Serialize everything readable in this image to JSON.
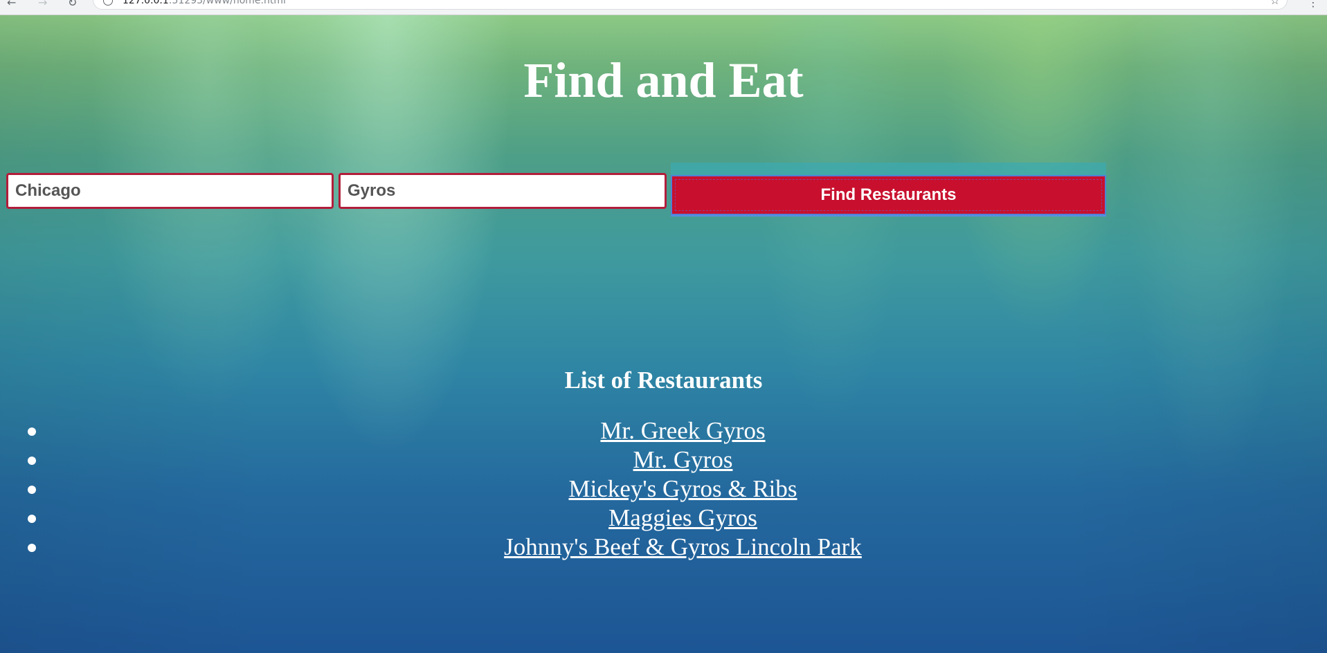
{
  "browser": {
    "url_host": "127.0.0.1",
    "url_path": ":51293/www/home.html"
  },
  "page": {
    "title": "Find and Eat"
  },
  "search": {
    "city_value": "Chicago",
    "food_value": "Gyros",
    "button_label": "Find Restaurants"
  },
  "results": {
    "heading": "List of Restaurants",
    "items": [
      "Mr. Greek Gyros",
      "Mr. Gyros",
      "Mickey's Gyros & Ribs",
      "Maggies Gyros",
      "Johnny's Beef & Gyros Lincoln Park"
    ]
  },
  "colors": {
    "accent_red": "#c8102e",
    "input_border": "#b21d3a",
    "text_white": "#ffffff"
  }
}
